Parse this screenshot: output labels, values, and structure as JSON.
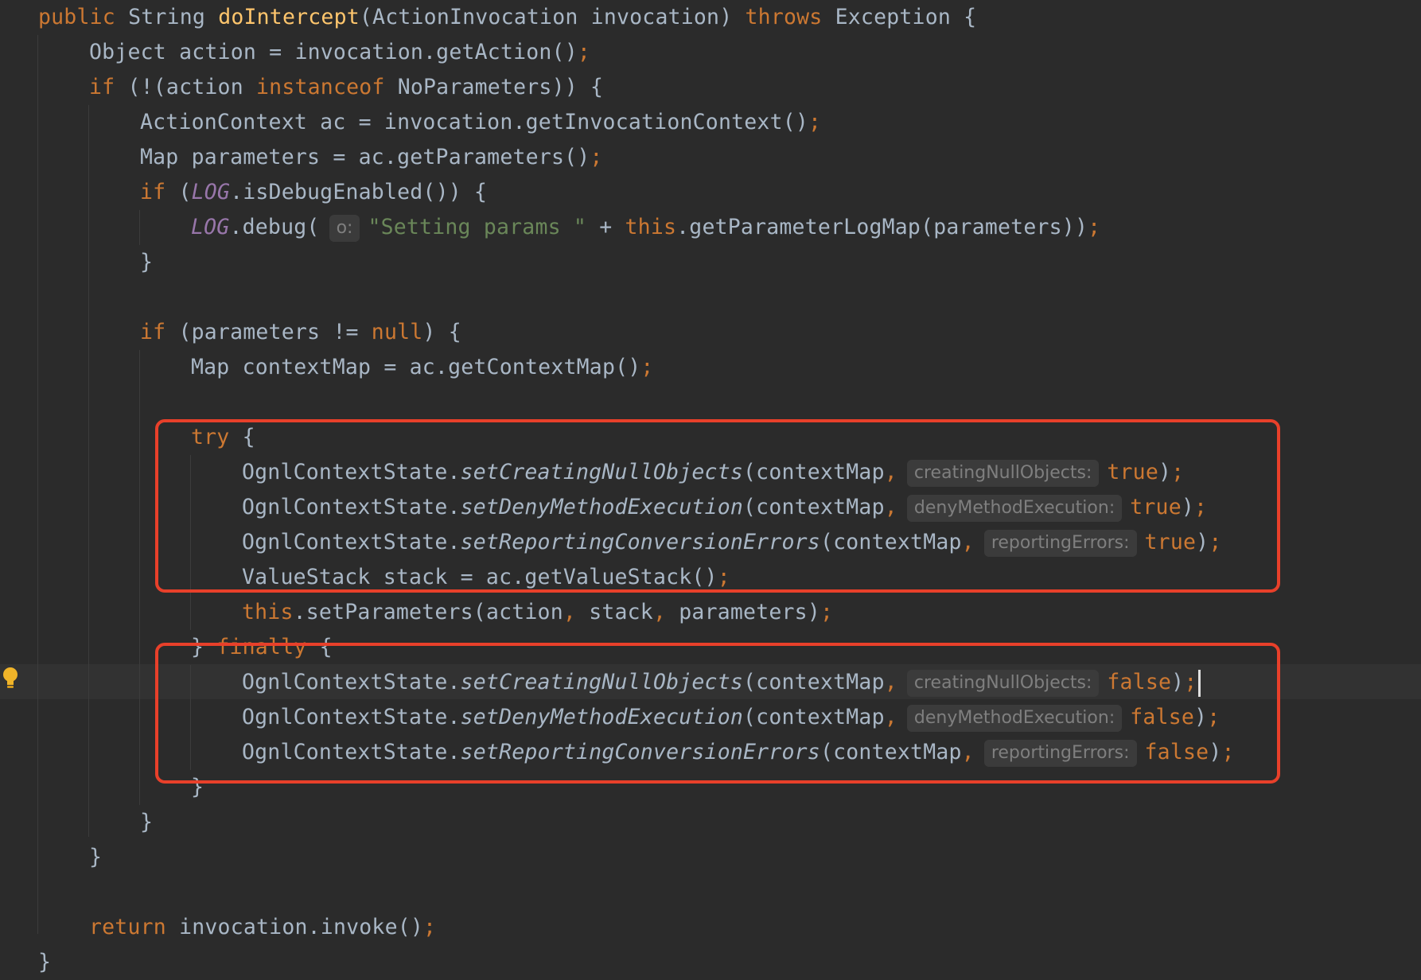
{
  "editor": {
    "language": "Java",
    "current_line_index": 19,
    "lines": [
      {
        "indent": 0,
        "tokens": [
          {
            "t": "public ",
            "c": "kw"
          },
          {
            "t": "String ",
            "c": ""
          },
          {
            "t": "doIntercept",
            "c": "fn"
          },
          {
            "t": "(ActionInvocation invocation) ",
            "c": ""
          },
          {
            "t": "throws ",
            "c": "kw"
          },
          {
            "t": "Exception {",
            "c": ""
          }
        ]
      },
      {
        "indent": 1,
        "tokens": [
          {
            "t": "Object action = invocation.getAction()",
            "c": ""
          },
          {
            "t": ";",
            "c": "pu"
          }
        ]
      },
      {
        "indent": 1,
        "tokens": [
          {
            "t": "if ",
            "c": "kw"
          },
          {
            "t": "(!(action ",
            "c": ""
          },
          {
            "t": "instanceof ",
            "c": "kw"
          },
          {
            "t": "NoParameters)) {",
            "c": ""
          }
        ]
      },
      {
        "indent": 2,
        "tokens": [
          {
            "t": "ActionContext ac = invocation.getInvocationContext()",
            "c": ""
          },
          {
            "t": ";",
            "c": "pu"
          }
        ]
      },
      {
        "indent": 2,
        "tokens": [
          {
            "t": "Map parameters = ac.getParameters()",
            "c": ""
          },
          {
            "t": ";",
            "c": "pu"
          }
        ]
      },
      {
        "indent": 2,
        "tokens": [
          {
            "t": "if ",
            "c": "kw"
          },
          {
            "t": "(",
            "c": ""
          },
          {
            "t": "LOG",
            "c": "cn"
          },
          {
            "t": ".isDebugEnabled()) {",
            "c": ""
          }
        ]
      },
      {
        "indent": 3,
        "tokens": [
          {
            "t": "LOG",
            "c": "cn"
          },
          {
            "t": ".debug(",
            "c": ""
          },
          {
            "hint": "o:"
          },
          {
            "t": "\"Setting params \"",
            "c": "st"
          },
          {
            "t": " + ",
            "c": ""
          },
          {
            "t": "this",
            "c": "kw"
          },
          {
            "t": ".getParameterLogMap(parameters))",
            "c": ""
          },
          {
            "t": ";",
            "c": "pu"
          }
        ]
      },
      {
        "indent": 2,
        "tokens": [
          {
            "t": "}",
            "c": ""
          }
        ]
      },
      {
        "indent": 0,
        "tokens": []
      },
      {
        "indent": 2,
        "tokens": [
          {
            "t": "if ",
            "c": "kw"
          },
          {
            "t": "(parameters != ",
            "c": ""
          },
          {
            "t": "null",
            "c": "kw"
          },
          {
            "t": ") {",
            "c": ""
          }
        ]
      },
      {
        "indent": 3,
        "tokens": [
          {
            "t": "Map contextMap = ac.getContextMap()",
            "c": ""
          },
          {
            "t": ";",
            "c": "pu"
          }
        ]
      },
      {
        "indent": 0,
        "tokens": []
      },
      {
        "indent": 3,
        "tokens": [
          {
            "t": "try ",
            "c": "kw"
          },
          {
            "t": "{",
            "c": ""
          }
        ]
      },
      {
        "indent": 4,
        "tokens": [
          {
            "t": "OgnlContextState.",
            "c": ""
          },
          {
            "t": "setCreatingNullObjects",
            "c": "it"
          },
          {
            "t": "(contextMap",
            "c": ""
          },
          {
            "t": ",",
            "c": "pu"
          },
          {
            "hint": "creatingNullObjects:"
          },
          {
            "t": "true",
            "c": "kw"
          },
          {
            "t": ")",
            "c": ""
          },
          {
            "t": ";",
            "c": "pu"
          }
        ]
      },
      {
        "indent": 4,
        "tokens": [
          {
            "t": "OgnlContextState.",
            "c": ""
          },
          {
            "t": "setDenyMethodExecution",
            "c": "it"
          },
          {
            "t": "(contextMap",
            "c": ""
          },
          {
            "t": ",",
            "c": "pu"
          },
          {
            "hint": "denyMethodExecution:"
          },
          {
            "t": "true",
            "c": "kw"
          },
          {
            "t": ")",
            "c": ""
          },
          {
            "t": ";",
            "c": "pu"
          }
        ]
      },
      {
        "indent": 4,
        "tokens": [
          {
            "t": "OgnlContextState.",
            "c": ""
          },
          {
            "t": "setReportingConversionErrors",
            "c": "it"
          },
          {
            "t": "(contextMap",
            "c": ""
          },
          {
            "t": ",",
            "c": "pu"
          },
          {
            "hint": "reportingErrors:"
          },
          {
            "t": "true",
            "c": "kw"
          },
          {
            "t": ")",
            "c": ""
          },
          {
            "t": ";",
            "c": "pu"
          }
        ]
      },
      {
        "indent": 4,
        "tokens": [
          {
            "t": "ValueStack stack = ac.getValueStack()",
            "c": ""
          },
          {
            "t": ";",
            "c": "pu"
          }
        ]
      },
      {
        "indent": 4,
        "tokens": [
          {
            "t": "this",
            "c": "kw"
          },
          {
            "t": ".setParameters(action",
            "c": ""
          },
          {
            "t": ", ",
            "c": "pu"
          },
          {
            "t": "stack",
            "c": ""
          },
          {
            "t": ", ",
            "c": "pu"
          },
          {
            "t": "parameters)",
            "c": ""
          },
          {
            "t": ";",
            "c": "pu"
          }
        ]
      },
      {
        "indent": 3,
        "tokens": [
          {
            "t": "} ",
            "c": ""
          },
          {
            "t": "finally ",
            "c": "kw"
          },
          {
            "t": "{",
            "c": ""
          }
        ]
      },
      {
        "indent": 4,
        "caret": true,
        "tokens": [
          {
            "t": "OgnlContextState.",
            "c": ""
          },
          {
            "t": "setCreatingNullObjects",
            "c": "it"
          },
          {
            "t": "(contextMap",
            "c": ""
          },
          {
            "t": ",",
            "c": "pu"
          },
          {
            "hint": "creatingNullObjects:"
          },
          {
            "t": "false",
            "c": "kw"
          },
          {
            "t": ")",
            "c": ""
          },
          {
            "t": ";",
            "c": "pu"
          }
        ]
      },
      {
        "indent": 4,
        "tokens": [
          {
            "t": "OgnlContextState.",
            "c": ""
          },
          {
            "t": "setDenyMethodExecution",
            "c": "it"
          },
          {
            "t": "(contextMap",
            "c": ""
          },
          {
            "t": ",",
            "c": "pu"
          },
          {
            "hint": "denyMethodExecution:"
          },
          {
            "t": "false",
            "c": "kw"
          },
          {
            "t": ")",
            "c": ""
          },
          {
            "t": ";",
            "c": "pu"
          }
        ]
      },
      {
        "indent": 4,
        "tokens": [
          {
            "t": "OgnlContextState.",
            "c": ""
          },
          {
            "t": "setReportingConversionErrors",
            "c": "it"
          },
          {
            "t": "(contextMap",
            "c": ""
          },
          {
            "t": ",",
            "c": "pu"
          },
          {
            "hint": "reportingErrors:"
          },
          {
            "t": "false",
            "c": "kw"
          },
          {
            "t": ")",
            "c": ""
          },
          {
            "t": ";",
            "c": "pu"
          }
        ]
      },
      {
        "indent": 3,
        "tokens": [
          {
            "t": "}",
            "c": ""
          }
        ]
      },
      {
        "indent": 2,
        "tokens": [
          {
            "t": "}",
            "c": ""
          }
        ]
      },
      {
        "indent": 1,
        "tokens": [
          {
            "t": "}",
            "c": ""
          }
        ]
      },
      {
        "indent": 0,
        "tokens": []
      },
      {
        "indent": 1,
        "tokens": [
          {
            "t": "return ",
            "c": "kw"
          },
          {
            "t": "invocation.invoke()",
            "c": ""
          },
          {
            "t": ";",
            "c": "pu"
          }
        ]
      },
      {
        "indent": 0,
        "tokens": [
          {
            "t": "}",
            "c": ""
          }
        ]
      }
    ]
  },
  "gutter": {
    "intention_icon": "lightbulb-icon"
  },
  "annotations": {
    "highlight_color": "#e8402a",
    "boxes": [
      "try-block-highlight",
      "finally-block-highlight"
    ]
  },
  "colors": {
    "background": "#2b2b2b",
    "text": "#a9b7c6",
    "keyword": "#cc7832",
    "method_declaration": "#ffc66d",
    "string": "#6a8759",
    "constant": "#9876aa",
    "inlay_hint": "#7f7f7f"
  }
}
